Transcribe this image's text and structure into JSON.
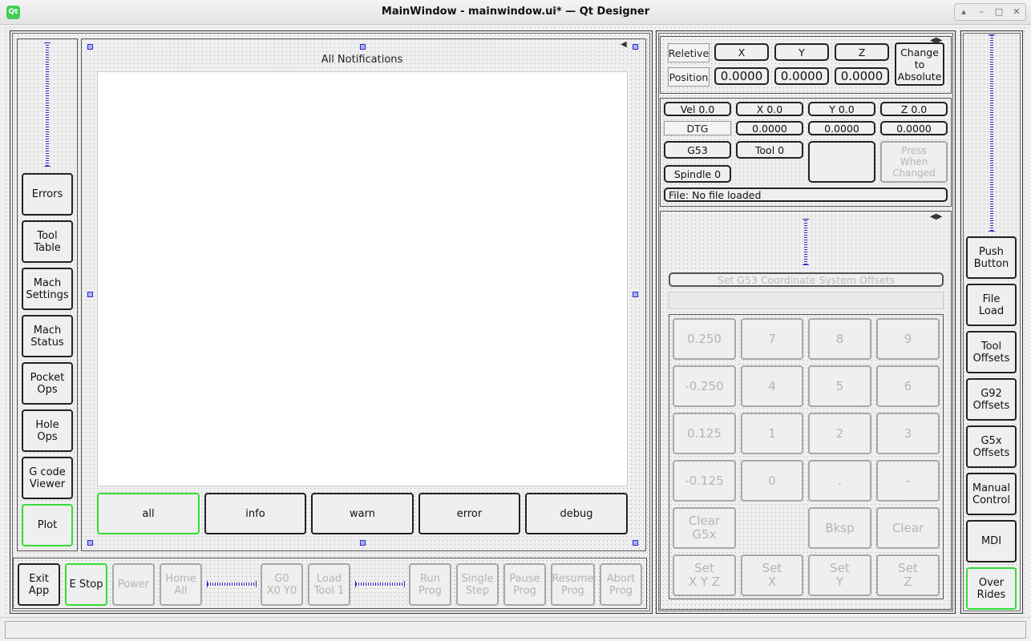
{
  "window": {
    "title": "MainWindow - mainwindow.ui* — Qt Designer",
    "app_icon_text": "Qt",
    "controls": [
      "▴",
      "–",
      "□",
      "✕"
    ]
  },
  "left_nav": {
    "buttons": [
      "Errors",
      "Tool\nTable",
      "Mach\nSettings",
      "Mach\nStatus",
      "Pocket\nOps",
      "Hole\nOps",
      "G code\nViewer",
      "Plot"
    ]
  },
  "notifications": {
    "title": "All Notifications",
    "filters": [
      "all",
      "info",
      "warn",
      "error",
      "debug"
    ]
  },
  "bottom_bar": {
    "exit": "Exit\nApp",
    "estop": "E Stop",
    "group1": [
      "Power",
      "Home\nAll"
    ],
    "group2": [
      "G0\nX0 Y0",
      "Load\nTool 1"
    ],
    "group3": [
      "Run\nProg",
      "Single\nStep",
      "Pause\nProg",
      "Resume\nProg",
      "Abort\nProg"
    ]
  },
  "position": {
    "mode_label": "Reletive",
    "position_label": "Position",
    "axes": [
      "X",
      "Y",
      "Z"
    ],
    "values": [
      "0.0000",
      "0.0000",
      "0.0000"
    ],
    "change_button": "Change to\nAbsolute"
  },
  "status": {
    "vel": "Vel 0.0",
    "x": "X 0.0",
    "y": "Y 0.0",
    "z": "Z 0.0",
    "dtg": "DTG",
    "dtg_values": [
      "0.0000",
      "0.0000",
      "0.0000"
    ],
    "g53": "G53",
    "tool": "Tool 0",
    "spindle": "Spindle 0",
    "press_when_changed": "Press\nWhen\nChanged",
    "file": "File: No file loaded"
  },
  "offsets": {
    "title": "Set G53 Coordinate System Offsets",
    "keypad": [
      [
        "0.250",
        "7",
        "8",
        "9"
      ],
      [
        "-0.250",
        "4",
        "5",
        "6"
      ],
      [
        "0.125",
        "1",
        "2",
        "3"
      ],
      [
        "-0.125",
        "0",
        ".",
        "-"
      ],
      [
        "Clear\nG5x",
        "",
        "Bksp",
        "Clear"
      ],
      [
        "Set\nX Y Z",
        "Set\nX",
        "Set\nY",
        "Set\nZ"
      ]
    ]
  },
  "right_nav": {
    "buttons": [
      "Push\nButton",
      "File\nLoad",
      "Tool\nOffsets",
      "G92\nOffsets",
      "G5x\nOffsets",
      "Manual\nControl",
      "MDI",
      "Over\nRides"
    ]
  }
}
